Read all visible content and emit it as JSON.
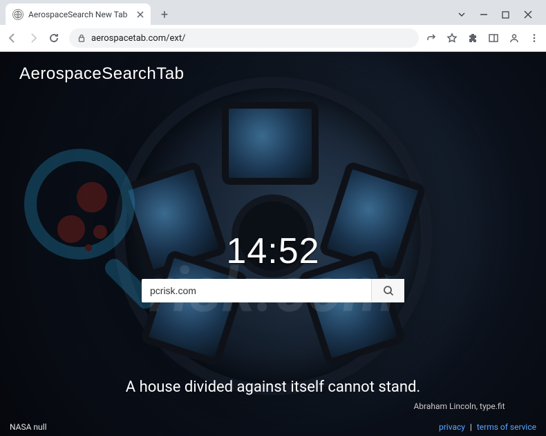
{
  "browser": {
    "tab_title": "AerospaceSearch New Tab",
    "url": "aerospacetab.com/ext/"
  },
  "page": {
    "brand": "AerospaceSearchTab",
    "clock": "14:52",
    "search_value": "pcrisk.com",
    "quote_text": "A house divided against itself cannot stand.",
    "quote_author": "Abraham Lincoln, type.fit",
    "credit": "NASA null",
    "footer": {
      "privacy": "privacy",
      "sep": "|",
      "terms": "terms of service"
    }
  },
  "watermark": "risk.com"
}
